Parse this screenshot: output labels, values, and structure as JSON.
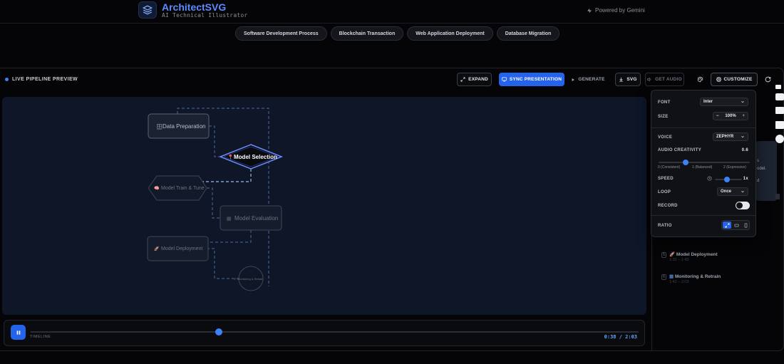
{
  "header": {
    "title": "ArchitectSVG",
    "subtitle": "AI Technical Illustrator",
    "powered_by": "Powered by Gemini"
  },
  "presets": [
    {
      "label": "Software Development Process"
    },
    {
      "label": "Blockchain Transaction"
    },
    {
      "label": "Web Application Deployment"
    },
    {
      "label": "Database Migration"
    }
  ],
  "preview": {
    "label": "LIVE PIPELINE PREVIEW"
  },
  "toolbar": {
    "expand": "EXPAND",
    "sync": "SYNC PRESENTATION",
    "generate": "GENERATE",
    "svg": "SVG",
    "get_audio": "GET AUDIO",
    "customize": "CUSTOMIZE"
  },
  "diagram": {
    "nodes": [
      {
        "id": "data-prep",
        "label": "Data Preparation",
        "icon": "database-icon",
        "shape": "rect",
        "state": "done"
      },
      {
        "id": "model-select",
        "label": "Model Selection",
        "icon": "pin-icon",
        "shape": "diamond",
        "state": "active"
      },
      {
        "id": "train",
        "label": "Model Train & Tune",
        "icon": "brain-icon",
        "shape": "hexagon",
        "state": "pending"
      },
      {
        "id": "eval",
        "label": "Model Evaluation",
        "icon": "chart-icon",
        "shape": "rect",
        "state": "pending"
      },
      {
        "id": "deploy",
        "label": "Model Deployment",
        "icon": "rocket-icon",
        "shape": "rect",
        "state": "pending"
      },
      {
        "id": "monitor",
        "label": "Monitoring & Retrain",
        "icon": "refresh-icon",
        "shape": "circle",
        "state": "pending"
      }
    ]
  },
  "timeline": {
    "label": "TIMELINE",
    "current": "0:38",
    "total": "2:03",
    "time_display": "0:38 / 2:03",
    "progress": 0.31
  },
  "customize_panel": {
    "font_label": "FONT",
    "font_value": "Inter",
    "size_label": "SIZE",
    "size_value": "100%",
    "size_minus": "−",
    "size_plus": "+",
    "voice_label": "VOICE",
    "voice_value": "ZEPHYR",
    "creativity_label": "AUDIO CREATIVITY",
    "creativity_value": "0.6",
    "creativity_level": 0.3,
    "scale_0": "0 (Consistent)",
    "scale_1": "1 (Balanced)",
    "scale_2": "2 (Expressive)",
    "speed_label": "SPEED",
    "speed_value": "1x",
    "loop_label": "LOOP",
    "loop_value": "Once",
    "record_label": "RECORD",
    "record_on": false,
    "ratio_label": "RATIO"
  },
  "sidebar": {
    "card_lines": [
      "s",
      "odel.",
      "d"
    ],
    "steps": [
      {
        "index": "5",
        "name": "Model Deployment",
        "icon": "rocket-icon",
        "time": "1:32 – 1:42"
      },
      {
        "index": "6",
        "name": "Monitoring & Retrain",
        "icon": "chart-icon",
        "time": "1:42 – 2:03"
      }
    ]
  },
  "colors": {
    "accent": "#2563eb",
    "accent_light": "#3b82f6",
    "canvas_bg": "#0e1628",
    "page_bg": "#050507"
  }
}
